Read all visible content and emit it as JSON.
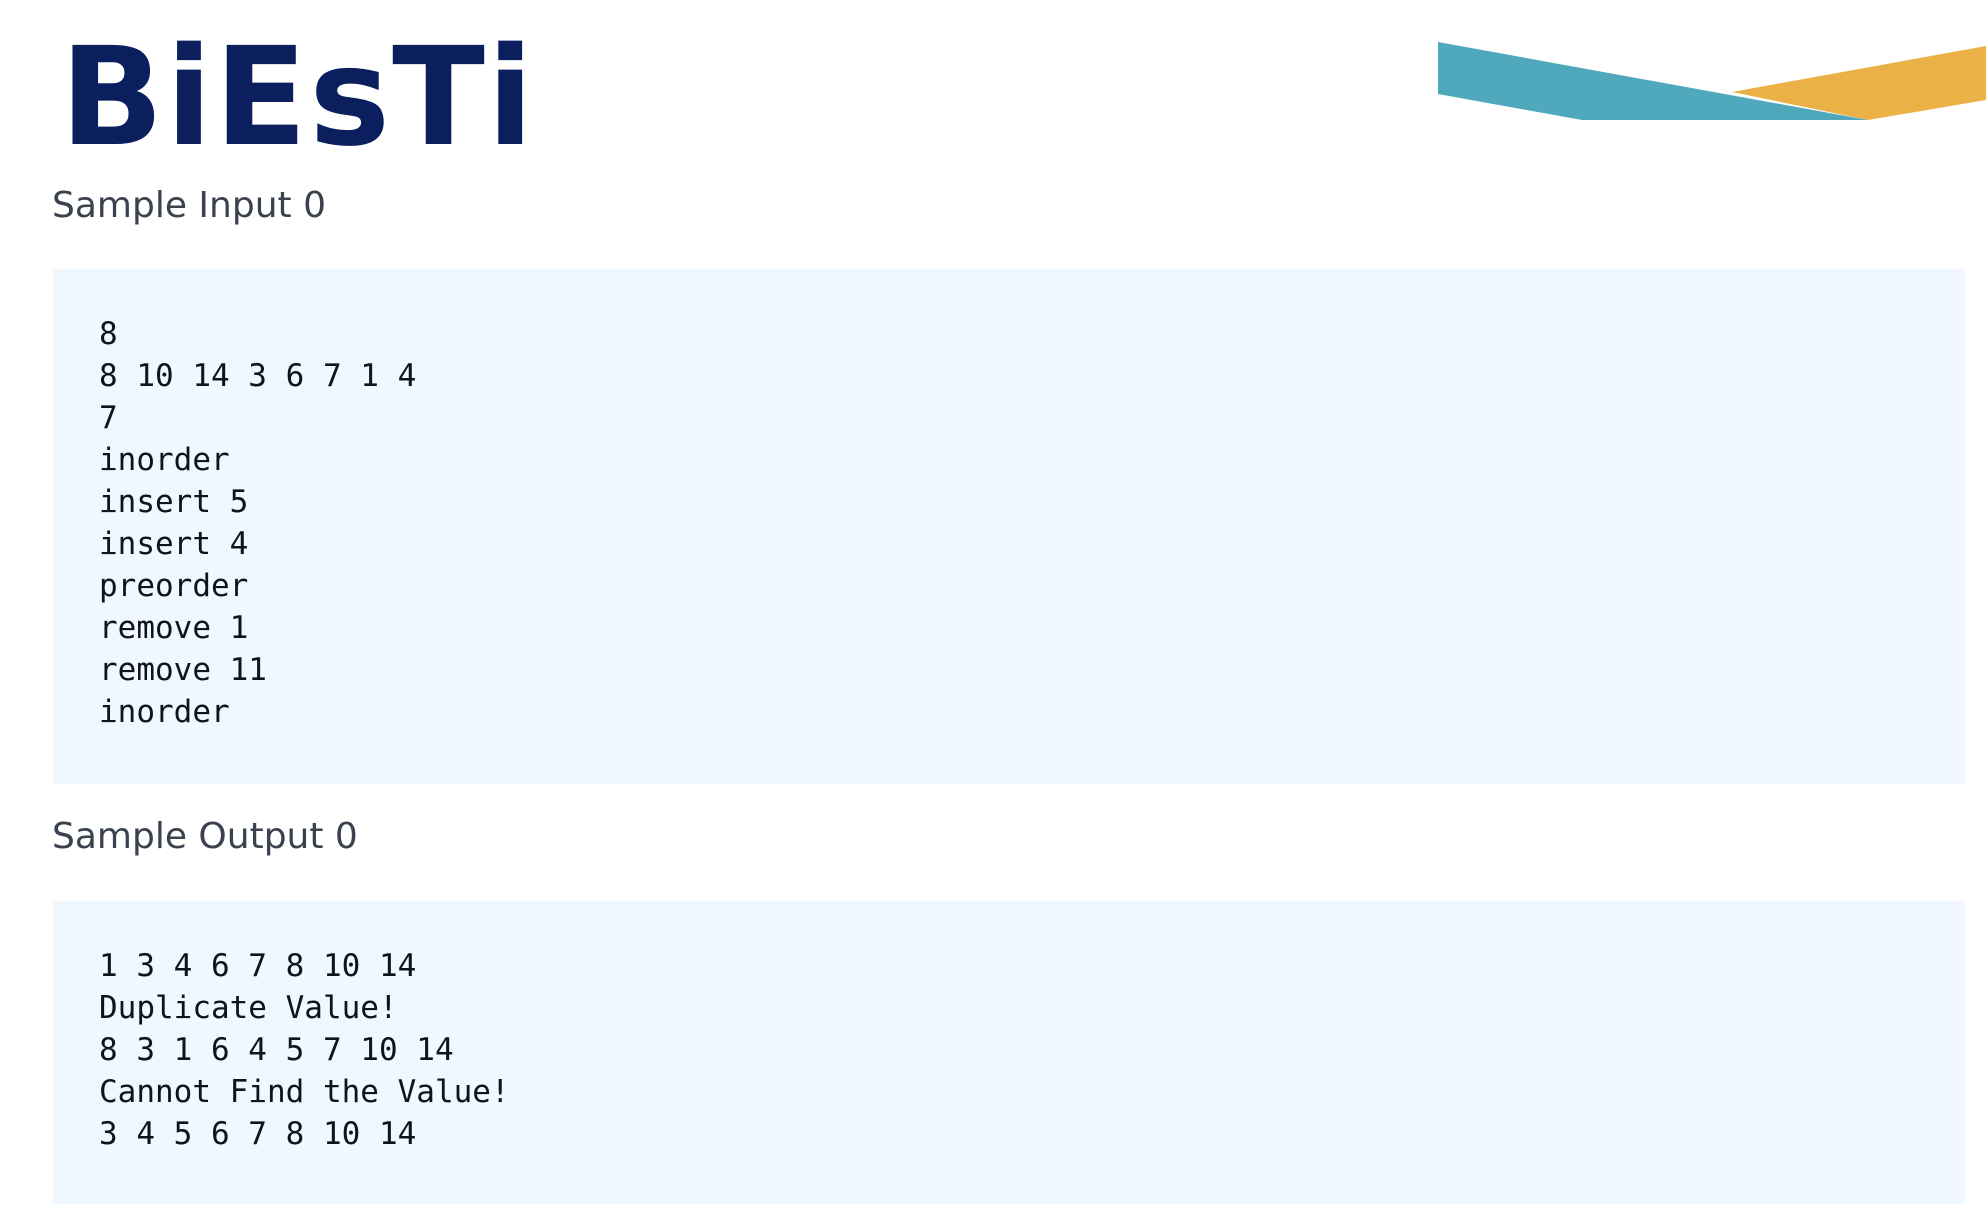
{
  "logo": {
    "text": "BiEsTi",
    "colors": {
      "text": "#0b1f5e",
      "banner_teal": "#4fa8bb",
      "banner_gold": "#ecb146"
    }
  },
  "sample_input": {
    "heading": "Sample Input 0",
    "lines": [
      "8",
      "8 10 14 3 6 7 1 4",
      "7",
      "inorder",
      "insert 5",
      "insert 4",
      "preorder",
      "remove 1",
      "remove 11",
      "inorder"
    ]
  },
  "sample_output": {
    "heading": "Sample Output 0",
    "lines": [
      "1 3 4 6 7 8 10 14",
      "Duplicate Value!",
      "8 3 1 6 4 5 7 10 14",
      "Cannot Find the Value!",
      "3 4 5 6 7 8 10 14"
    ]
  },
  "theme": {
    "code_background": "#f0f7fe",
    "heading_color": "#39424e"
  }
}
